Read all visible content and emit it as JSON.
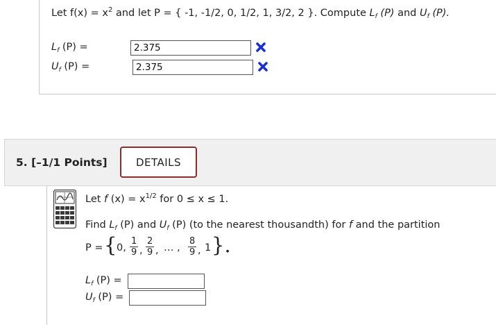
{
  "previous_question": {
    "statement_prefix": "Let f(x) = x",
    "exponent": "2",
    "statement_middle": " and let P = { -1, -1/2, 0, 1/2, 1, 3/2, 2 }. Compute ",
    "lower_name": "L",
    "lower_sub": "f",
    "lower_arg": " (P)",
    "and_word": " and ",
    "upper_name": "U",
    "upper_sub": "f",
    "upper_arg": " (P).",
    "lower_label_prefix": "L",
    "lower_label_sub": "f",
    "lower_label_suffix": " (P) = ",
    "lower_value": "2.375",
    "upper_label_prefix": "U",
    "upper_label_sub": "f",
    "upper_label_suffix": " (P) = ",
    "upper_value": "2.375",
    "incorrect_icon": "x-mark-icon",
    "incorrect_color": "#1a2fd6"
  },
  "question": {
    "number_label": "5.  [–1/1 Points]",
    "details_label": "DETAILS",
    "details_border_color": "#8b2c2c",
    "tool_icon": "calculator-graph-icon",
    "line1_prefix": "Let ",
    "line1_f": "f",
    "line1_mid": " (x) = x",
    "line1_exp": "1/2",
    "line1_suffix": " for 0 ≤ x ≤ 1.",
    "line2_prefix": "Find ",
    "line2_L": "L",
    "line2_Lsub": "f",
    "line2_Larg": " (P) and ",
    "line2_U": "U",
    "line2_Usub": "f",
    "line2_Uarg": " (P) (to the nearest thousandth) for ",
    "line2_f": "f",
    "line2_suffix": " and the partition",
    "partition": {
      "lhs": "P =",
      "open_brace": "{",
      "first": "0,",
      "frac1_num": "1",
      "frac1_den": "9",
      "comma1": ",",
      "frac2_num": "2",
      "frac2_den": "9",
      "comma2": ",",
      "ellipsis": "… ,",
      "frac3_num": "8",
      "frac3_den": "9",
      "comma3": ",",
      "last": "1",
      "close_brace": "}.",
      "dot": ""
    },
    "lower_label_prefix": "L",
    "lower_label_sub": "f",
    "lower_label_suffix": " (P) = ",
    "lower_value": "",
    "upper_label_prefix": "U",
    "upper_label_sub": "f",
    "upper_label_suffix": " (P) = ",
    "upper_value": ""
  }
}
